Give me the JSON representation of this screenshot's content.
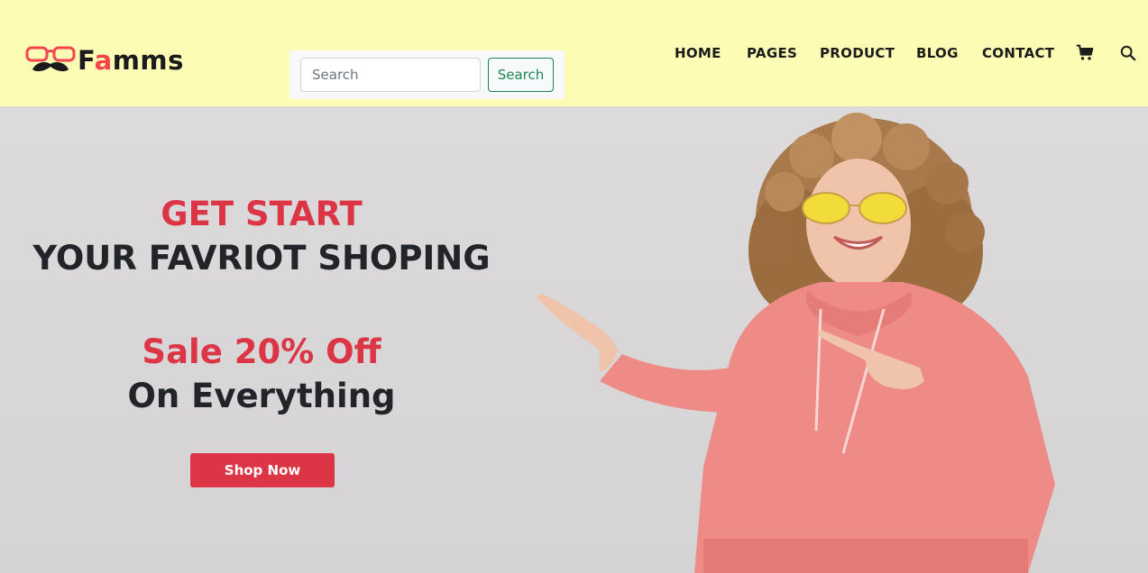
{
  "brand": {
    "name_prefix": "F",
    "name_accent": "a",
    "name_suffix": "mms",
    "accent_color": "#f7444e",
    "header_bg": "#fcfcb4"
  },
  "search": {
    "placeholder": "Search",
    "value": "",
    "button_label": "Search"
  },
  "nav": {
    "items": [
      {
        "label": "HOME"
      },
      {
        "label": "PAGES"
      },
      {
        "label": "PRODUCT"
      },
      {
        "label": "BLOG"
      },
      {
        "label": "CONTACT"
      }
    ],
    "cart_icon": "shopping-cart-icon",
    "search_icon": "magnifier-icon"
  },
  "hero": {
    "line1": "GET START",
    "line2": "YOUR FAVRIOT SHOPING",
    "line3": "Sale 20% Off",
    "line4": "On Everything",
    "cta_label": "Shop Now",
    "highlight_color": "#dc3545",
    "image_icon": "woman-pointing-image"
  }
}
